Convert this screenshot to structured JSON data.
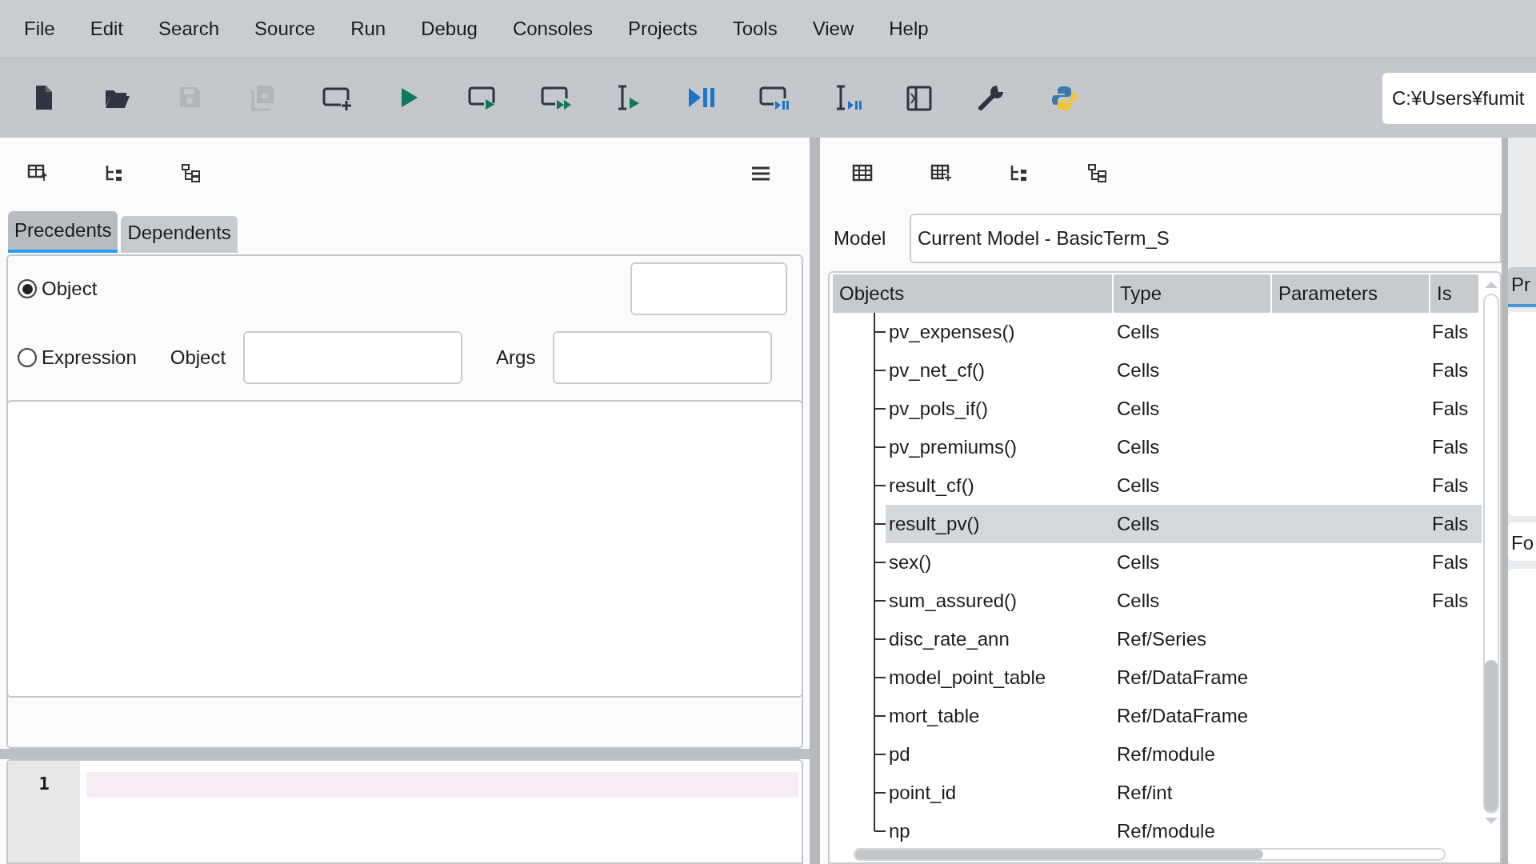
{
  "menu": [
    "File",
    "Edit",
    "Search",
    "Source",
    "Run",
    "Debug",
    "Consoles",
    "Projects",
    "Tools",
    "View",
    "Help"
  ],
  "toolbar": [
    {
      "kind": "new-file",
      "disabled": false
    },
    {
      "kind": "open",
      "disabled": false
    },
    {
      "kind": "save",
      "disabled": true
    },
    {
      "kind": "save-all",
      "disabled": true
    },
    {
      "kind": "new-cell",
      "disabled": false
    },
    {
      "kind": "run",
      "disabled": false
    },
    {
      "kind": "run-cell",
      "disabled": false
    },
    {
      "kind": "run-cell-advance",
      "disabled": false
    },
    {
      "kind": "run-selection",
      "disabled": false
    },
    {
      "kind": "debug",
      "disabled": false
    },
    {
      "kind": "debug-cell",
      "disabled": false
    },
    {
      "kind": "debug-selection",
      "disabled": false
    },
    {
      "kind": "maximize",
      "disabled": false
    },
    {
      "kind": "wrench",
      "disabled": false
    },
    {
      "kind": "python",
      "disabled": false
    }
  ],
  "path": "C:¥Users¥fumit",
  "left_pane": {
    "tools": [
      {
        "kind": "table-up"
      },
      {
        "kind": "tree"
      },
      {
        "kind": "tree-boxes"
      }
    ],
    "tabs": [
      {
        "label": "Precedents",
        "selected": true
      },
      {
        "label": "Dependents",
        "selected": false
      }
    ],
    "radios": [
      {
        "label": "Object",
        "selected": true
      },
      {
        "label": "Expression",
        "selected": false
      }
    ],
    "object_label": "Object",
    "args_label": "Args",
    "editor": {
      "line_numbers": [
        "1"
      ]
    }
  },
  "right_pane": {
    "tools": [
      {
        "kind": "table"
      },
      {
        "kind": "table-plus"
      },
      {
        "kind": "tree"
      },
      {
        "kind": "tree-boxes"
      }
    ],
    "model_label": "Model",
    "model_value": "Current Model - BasicTerm_S",
    "table": {
      "columns": [
        "Objects",
        "Type",
        "Parameters",
        "Is"
      ],
      "rows": [
        {
          "name": "pv_expenses()",
          "type": "Cells",
          "column_4": "Fals",
          "selected": false
        },
        {
          "name": "pv_net_cf()",
          "type": "Cells",
          "column_4": "Fals",
          "selected": false
        },
        {
          "name": "pv_pols_if()",
          "type": "Cells",
          "column_4": "Fals",
          "selected": false
        },
        {
          "name": "pv_premiums()",
          "type": "Cells",
          "column_4": "Fals",
          "selected": false
        },
        {
          "name": "result_cf()",
          "type": "Cells",
          "column_4": "Fals",
          "selected": false
        },
        {
          "name": "result_pv()",
          "type": "Cells",
          "column_4": "Fals",
          "selected": true
        },
        {
          "name": "sex()",
          "type": "Cells",
          "column_4": "Fals",
          "selected": false
        },
        {
          "name": "sum_assured()",
          "type": "Cells",
          "column_4": "Fals",
          "selected": false
        },
        {
          "name": "disc_rate_ann",
          "type": "Ref/Series",
          "selected": false
        },
        {
          "name": "model_point_table",
          "type": "Ref/DataFrame",
          "selected": false
        },
        {
          "name": "mort_table",
          "type": "Ref/DataFrame",
          "selected": false
        },
        {
          "name": "pd",
          "type": "Ref/module",
          "selected": false
        },
        {
          "name": "point_id",
          "type": "Ref/int",
          "selected": false
        },
        {
          "name": "np",
          "type": "Ref/module",
          "selected": false
        }
      ]
    }
  },
  "side_panel": {
    "tab": "Pr",
    "label": "Fo"
  }
}
